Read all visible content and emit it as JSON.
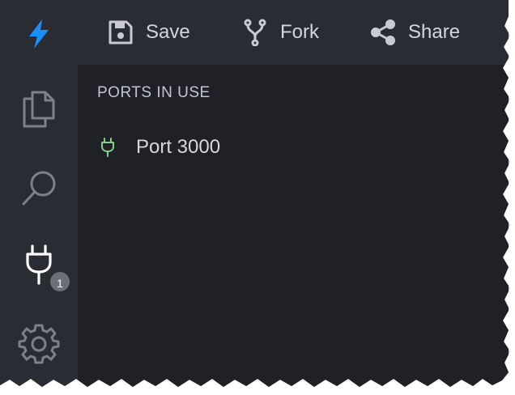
{
  "toolbar": {
    "save_label": "Save",
    "fork_label": "Fork",
    "share_label": "Share"
  },
  "activity_bar": {
    "items": [
      {
        "name": "files",
        "icon": "files-icon",
        "active": false
      },
      {
        "name": "search",
        "icon": "search-icon",
        "active": false
      },
      {
        "name": "ports",
        "icon": "plug-icon",
        "active": true,
        "badge": "1"
      },
      {
        "name": "settings",
        "icon": "gear-icon",
        "active": false
      }
    ]
  },
  "panel": {
    "title": "PORTS IN USE",
    "ports": [
      {
        "label": "Port 3000",
        "icon": "plug-icon",
        "status_color": "#7fd38a"
      }
    ]
  },
  "colors": {
    "accent": "#1a8fff",
    "background": "#2a2c33",
    "panel_background": "#1f2126",
    "port_active": "#7fd38a"
  }
}
